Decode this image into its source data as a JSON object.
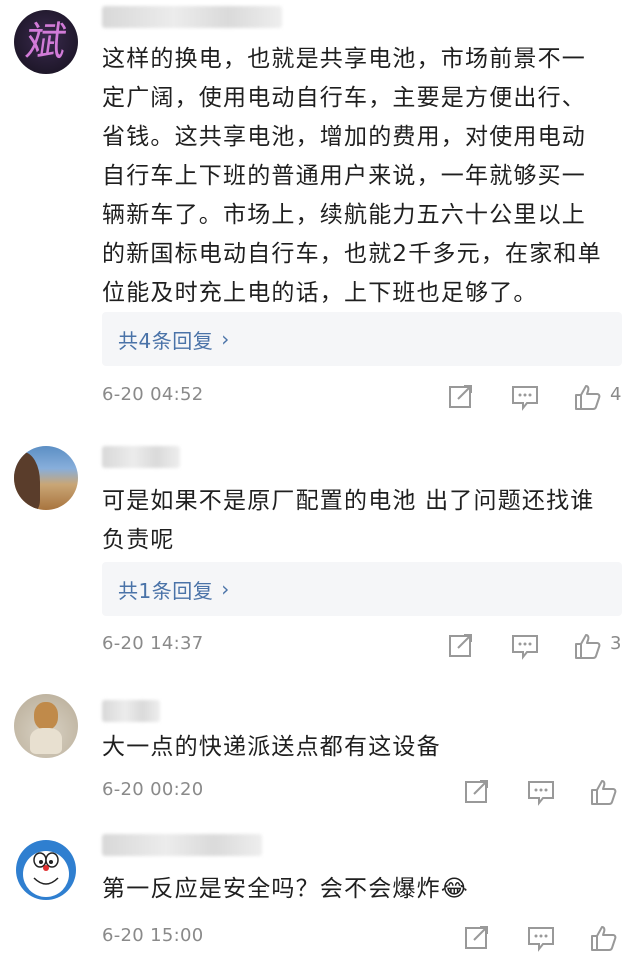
{
  "comments": [
    {
      "avatar_char": "斌",
      "lines": [
        "这样的换电，也就是共享电池，市场前景不一",
        "定广阔，使用电动自行车，主要是方便出行、",
        "省钱。这共享电池，增加的费用，对使用电动",
        "自行车上下班的普通用户来说，一年就够买一",
        "辆新车了。市场上，续航能力五六十公里以上",
        "的新国标电动自行车，也就2千多元，在家和单",
        "位能及时充上电的话，上下班也足够了。"
      ],
      "replies_label": "共4条回复",
      "time": "6-20 04:52",
      "likes": "4"
    },
    {
      "lines": [
        "可是如果不是原厂配置的电池 出了问题还找谁",
        "负责呢"
      ],
      "replies_label": "共1条回复",
      "time": "6-20 14:37",
      "likes": "3"
    },
    {
      "lines": [
        "大一点的快递派送点都有这设备"
      ],
      "time": "6-20 00:20"
    },
    {
      "lines": [
        "第一反应是安全吗？会不会爆炸😂"
      ],
      "time": "6-20 15:00"
    }
  ],
  "colors": {
    "link": "#4a73a8",
    "meta": "#8a8a8a",
    "reply_bg": "#f5f6f8"
  },
  "icons": [
    "share-icon",
    "comment-icon",
    "thumbs-up-icon"
  ]
}
